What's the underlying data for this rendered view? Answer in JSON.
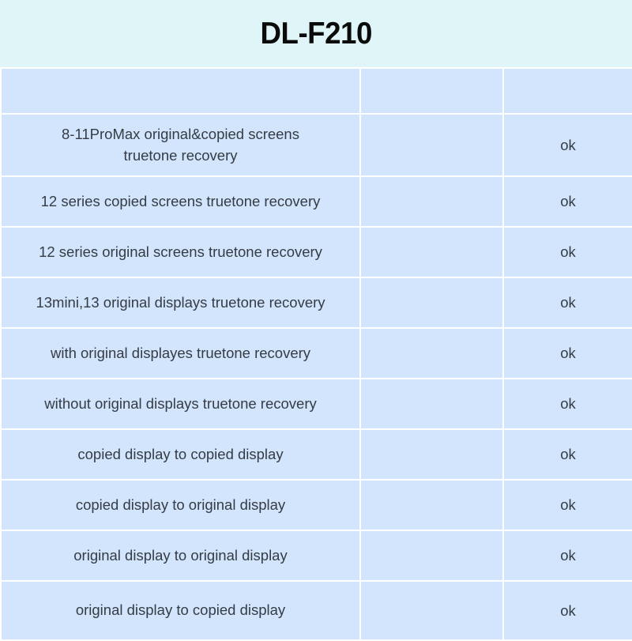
{
  "header": {
    "title": "DL-F210",
    "background_color": "#e0f5f7",
    "title_color": "#0b0b0b"
  },
  "table": {
    "cell_background": "#d2e5fc",
    "gridline_color": "#ffffff",
    "text_color": "#353c46",
    "columns": [
      {
        "key": "feature",
        "header": ""
      },
      {
        "key": "middle",
        "header": ""
      },
      {
        "key": "status",
        "header": ""
      }
    ],
    "rows": [
      {
        "feature_line1": "8-11ProMax original&copied screens",
        "feature_line2": "truetone recovery",
        "middle": "",
        "status": "ok"
      },
      {
        "feature": "12 series copied screens truetone recovery",
        "middle": "",
        "status": "ok"
      },
      {
        "feature": "12 series original screens truetone recovery",
        "middle": "",
        "status": "ok"
      },
      {
        "feature": "13mini,13 original displays truetone recovery",
        "middle": "",
        "status": "ok"
      },
      {
        "feature": "with original displayes truetone recovery",
        "middle": "",
        "status": "ok"
      },
      {
        "feature": "without original displays truetone recovery",
        "middle": "",
        "status": "ok"
      },
      {
        "feature": "copied display to copied display",
        "middle": "",
        "status": "ok"
      },
      {
        "feature": "copied display to original display",
        "middle": "",
        "status": "ok"
      },
      {
        "feature": "original display to original display",
        "middle": "",
        "status": "ok"
      },
      {
        "feature": "original display to copied display",
        "middle": "",
        "status": "ok"
      }
    ]
  }
}
